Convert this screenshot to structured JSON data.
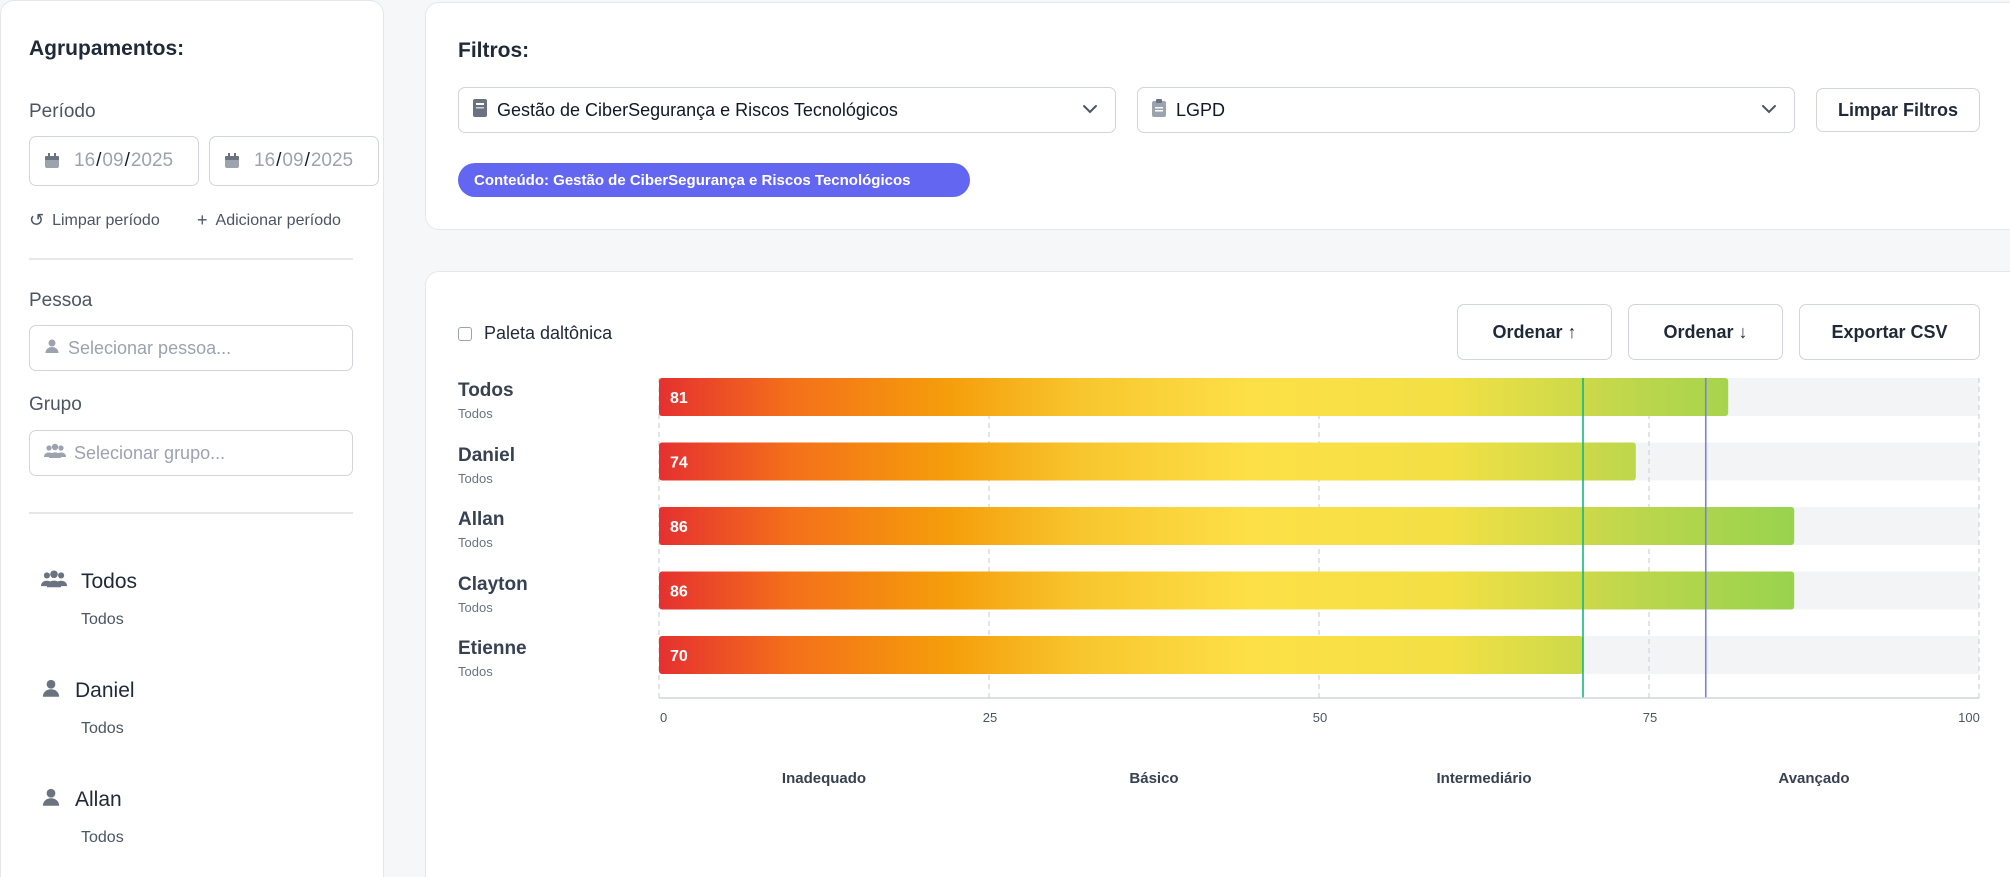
{
  "sidebar": {
    "title": "Agrupamentos:",
    "period_label": "Período",
    "date_start": {
      "day": "16",
      "month": "09",
      "year": "2025"
    },
    "date_end": {
      "day": "16",
      "month": "09",
      "year": "2025"
    },
    "clear_period": "Limpar período",
    "add_period": "Adicionar período",
    "person_label": "Pessoa",
    "person_placeholder": "Selecionar pessoa...",
    "group_label": "Grupo",
    "group_placeholder": "Selecionar grupo...",
    "groups": [
      {
        "name": "Todos",
        "sub": "Todos",
        "icon": "users-icon"
      },
      {
        "name": "Daniel",
        "sub": "Todos",
        "icon": "user-icon"
      },
      {
        "name": "Allan",
        "sub": "Todos",
        "icon": "user-icon"
      }
    ]
  },
  "filters": {
    "title": "Filtros:",
    "content_select": "Gestão de CiberSegurança e Riscos Tecnológicos",
    "topic_select": "LGPD",
    "clear_button": "Limpar Filtros",
    "chip": "Conteúdo: Gestão de CiberSegurança e Riscos Tecnológicos"
  },
  "toolbar": {
    "colorblind_label": "Paleta daltônica",
    "sort_asc": "Ordenar ↑",
    "sort_desc": "Ordenar ↓",
    "export_csv": "Exportar CSV"
  },
  "colors": {
    "accent": "#6366f1",
    "bar_red": "#e53030",
    "bar_orange": "#f59e0b",
    "bar_yellow": "#fde047",
    "bar_green": "#6fcf50",
    "marker_green": "#10b981",
    "marker_purple": "#7c7cf5"
  },
  "chart_data": {
    "type": "bar",
    "orientation": "horizontal",
    "categories": [
      "Todos",
      "Daniel",
      "Allan",
      "Clayton",
      "Etienne"
    ],
    "subcategories": [
      "Todos",
      "Todos",
      "Todos",
      "Todos",
      "Todos"
    ],
    "values": [
      81,
      74,
      86,
      86,
      70
    ],
    "xlim": [
      0,
      100
    ],
    "xticks": [
      0,
      25,
      50,
      75,
      100
    ],
    "levels": [
      "Inadequado",
      "Básico",
      "Intermediário",
      "Avançado"
    ],
    "reference_lines": [
      70,
      79.3
    ],
    "grid": true
  }
}
